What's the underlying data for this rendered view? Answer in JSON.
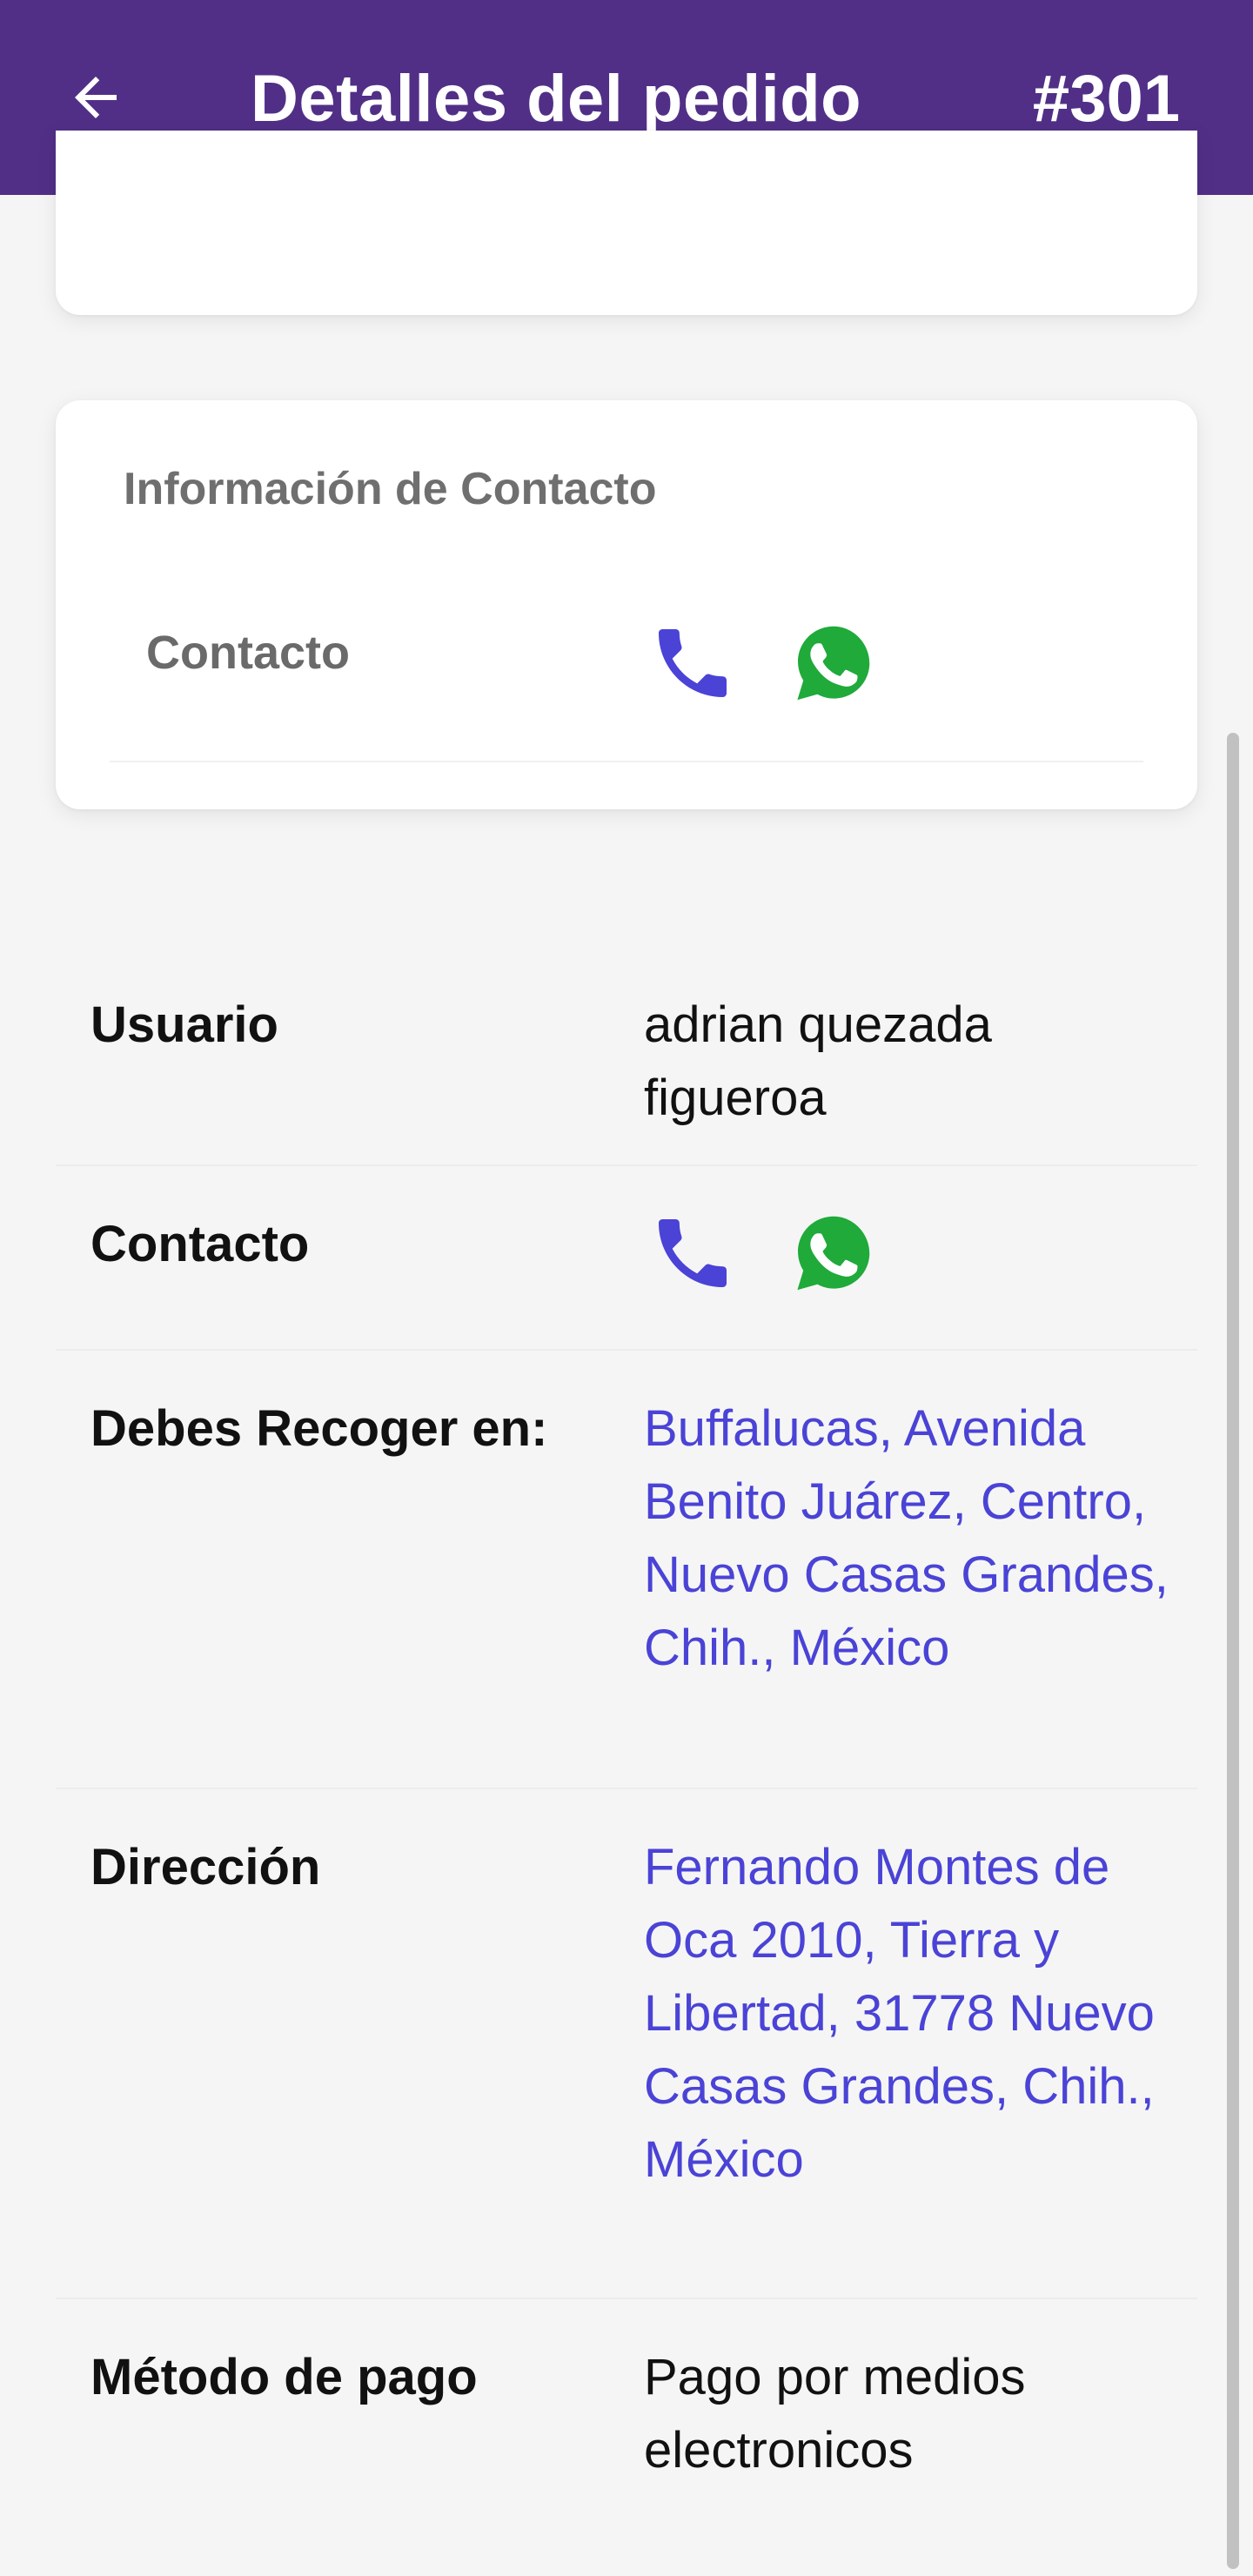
{
  "appbar": {
    "title": "Detalles del pedido",
    "order_number": "#301"
  },
  "contact_card": {
    "title": "Información de Contacto",
    "row_label": "Contacto"
  },
  "details": {
    "user_label": "Usuario",
    "user_value": "adrian quezada figueroa",
    "contact_label": "Contacto",
    "pickup_label": "Debes Recoger en:",
    "pickup_value": "Buffalucas, Avenida Benito Juárez, Centro, Nuevo Casas Grandes, Chih., México",
    "address_label": "Dirección",
    "address_value": "Fernando Montes de Oca 2010, Tierra y Libertad, 31778 Nuevo Casas Grandes, Chih., México",
    "payment_label": "Método de pago",
    "payment_value": "Pago por medios electronicos"
  },
  "icons": {
    "back": "arrow-back-icon",
    "phone": "phone-icon",
    "whatsapp": "whatsapp-icon"
  },
  "colors": {
    "appbar": "#512f87",
    "phone": "#4a43d6",
    "whatsapp": "#1faa3a",
    "link": "#4a43d6"
  }
}
